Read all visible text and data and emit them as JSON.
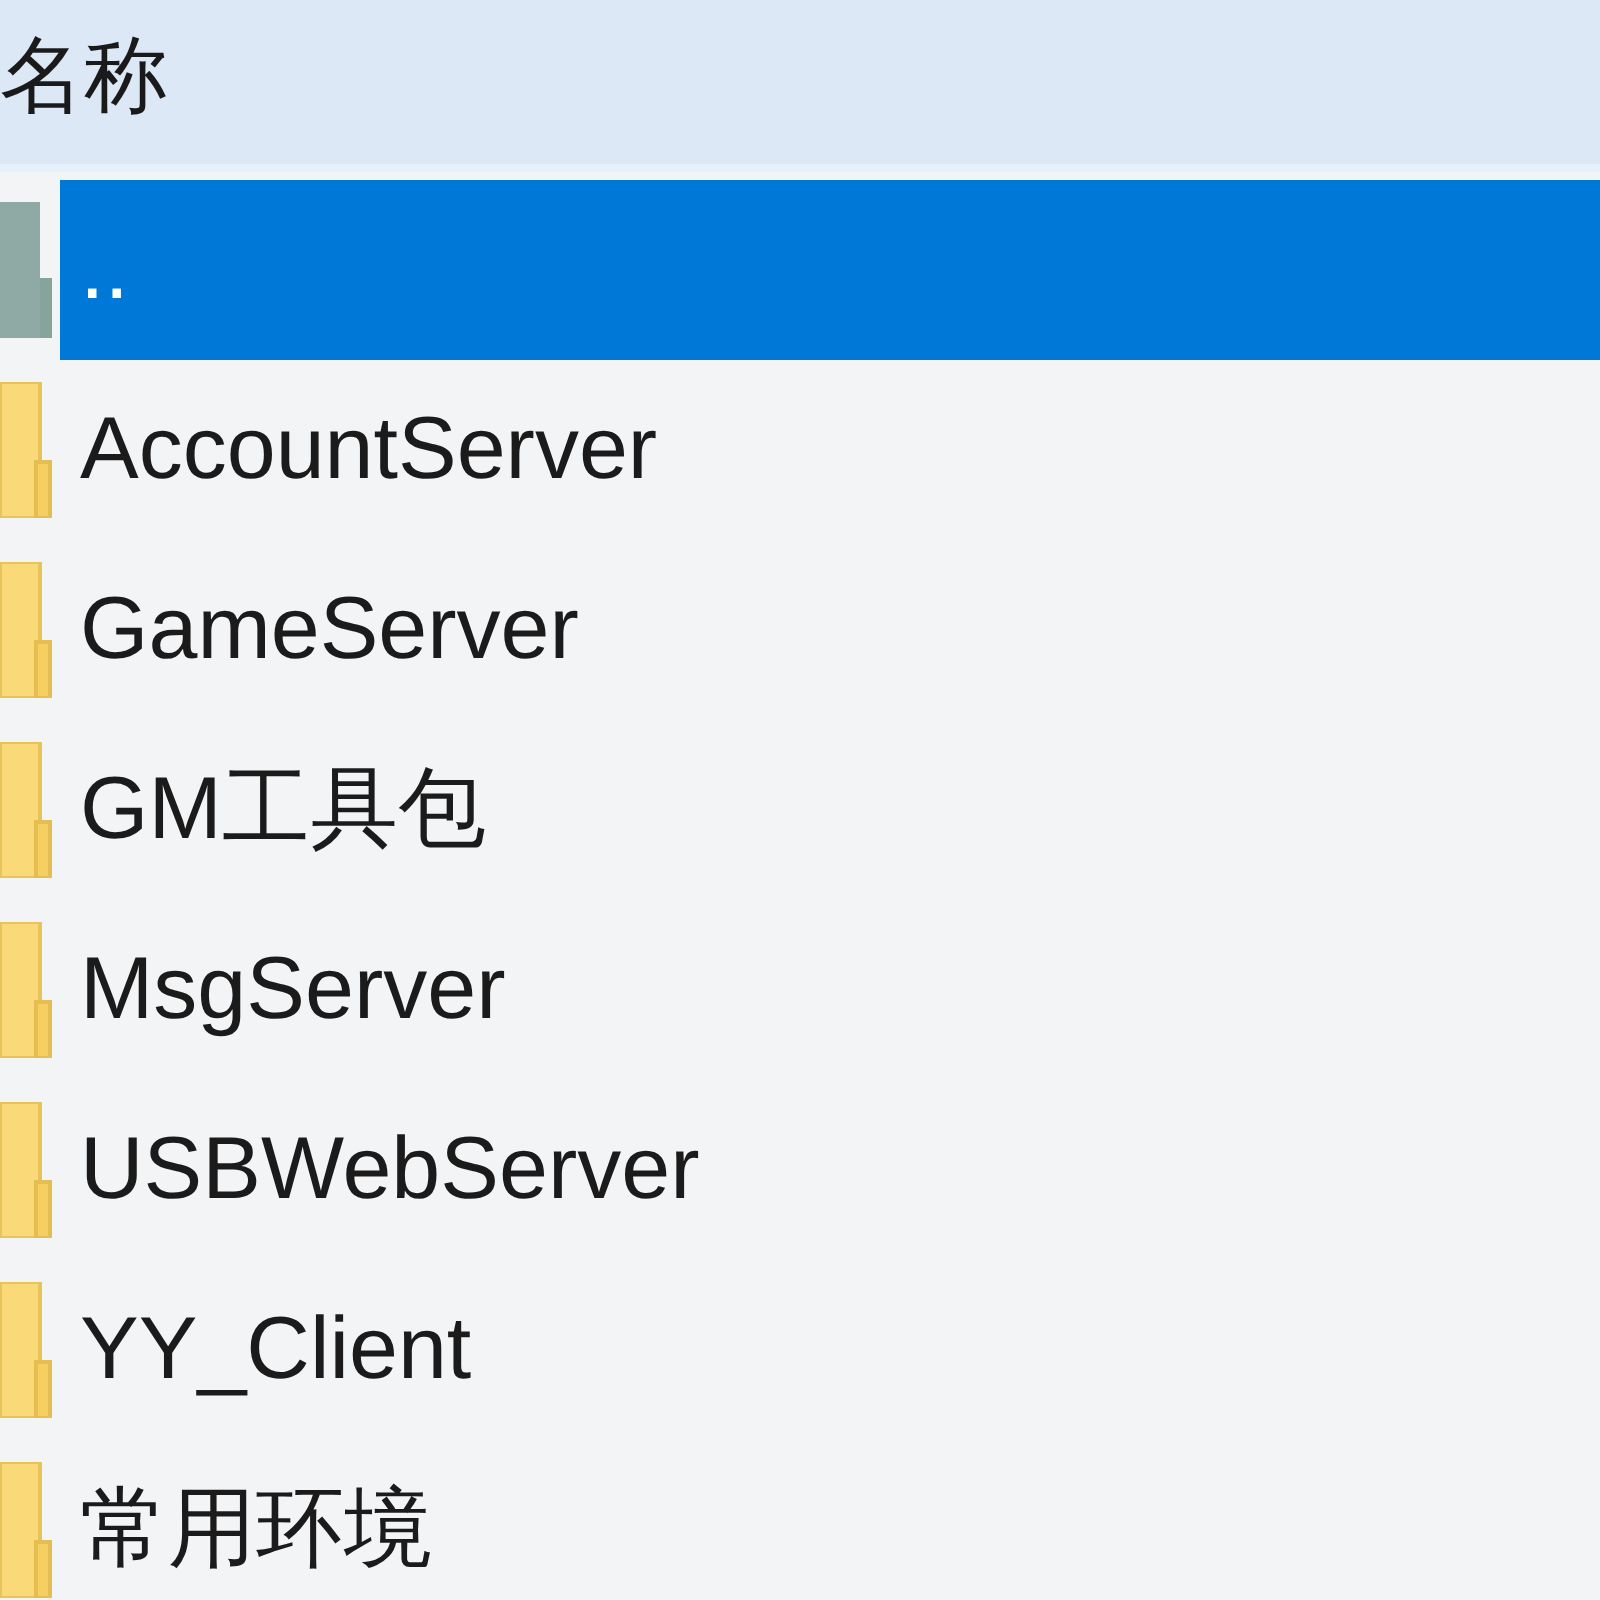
{
  "header": {
    "label": "名称"
  },
  "rows": [
    {
      "name": "..",
      "kind": "parent",
      "selected": true
    },
    {
      "name": "AccountServer",
      "kind": "folder",
      "selected": false
    },
    {
      "name": "GameServer",
      "kind": "folder",
      "selected": false
    },
    {
      "name": "GM工具包",
      "kind": "folder",
      "selected": false
    },
    {
      "name": "MsgServer",
      "kind": "folder",
      "selected": false
    },
    {
      "name": "USBWebServer",
      "kind": "folder",
      "selected": false
    },
    {
      "name": "YY_Client",
      "kind": "folder",
      "selected": false
    },
    {
      "name": "常用环境",
      "kind": "folder",
      "selected": false
    }
  ]
}
